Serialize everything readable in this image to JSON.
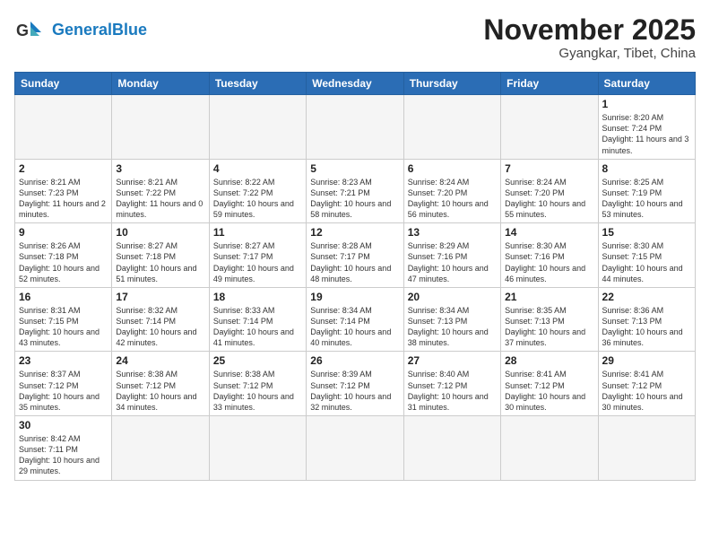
{
  "logo": {
    "general": "General",
    "blue": "Blue"
  },
  "title": "November 2025",
  "subtitle": "Gyangkar, Tibet, China",
  "days_of_week": [
    "Sunday",
    "Monday",
    "Tuesday",
    "Wednesday",
    "Thursday",
    "Friday",
    "Saturday"
  ],
  "weeks": [
    [
      {
        "day": "",
        "info": ""
      },
      {
        "day": "",
        "info": ""
      },
      {
        "day": "",
        "info": ""
      },
      {
        "day": "",
        "info": ""
      },
      {
        "day": "",
        "info": ""
      },
      {
        "day": "",
        "info": ""
      },
      {
        "day": "1",
        "info": "Sunrise: 8:20 AM\nSunset: 7:24 PM\nDaylight: 11 hours and 3 minutes."
      }
    ],
    [
      {
        "day": "2",
        "info": "Sunrise: 8:21 AM\nSunset: 7:23 PM\nDaylight: 11 hours and 2 minutes."
      },
      {
        "day": "3",
        "info": "Sunrise: 8:21 AM\nSunset: 7:22 PM\nDaylight: 11 hours and 0 minutes."
      },
      {
        "day": "4",
        "info": "Sunrise: 8:22 AM\nSunset: 7:22 PM\nDaylight: 10 hours and 59 minutes."
      },
      {
        "day": "5",
        "info": "Sunrise: 8:23 AM\nSunset: 7:21 PM\nDaylight: 10 hours and 58 minutes."
      },
      {
        "day": "6",
        "info": "Sunrise: 8:24 AM\nSunset: 7:20 PM\nDaylight: 10 hours and 56 minutes."
      },
      {
        "day": "7",
        "info": "Sunrise: 8:24 AM\nSunset: 7:20 PM\nDaylight: 10 hours and 55 minutes."
      },
      {
        "day": "8",
        "info": "Sunrise: 8:25 AM\nSunset: 7:19 PM\nDaylight: 10 hours and 53 minutes."
      }
    ],
    [
      {
        "day": "9",
        "info": "Sunrise: 8:26 AM\nSunset: 7:18 PM\nDaylight: 10 hours and 52 minutes."
      },
      {
        "day": "10",
        "info": "Sunrise: 8:27 AM\nSunset: 7:18 PM\nDaylight: 10 hours and 51 minutes."
      },
      {
        "day": "11",
        "info": "Sunrise: 8:27 AM\nSunset: 7:17 PM\nDaylight: 10 hours and 49 minutes."
      },
      {
        "day": "12",
        "info": "Sunrise: 8:28 AM\nSunset: 7:17 PM\nDaylight: 10 hours and 48 minutes."
      },
      {
        "day": "13",
        "info": "Sunrise: 8:29 AM\nSunset: 7:16 PM\nDaylight: 10 hours and 47 minutes."
      },
      {
        "day": "14",
        "info": "Sunrise: 8:30 AM\nSunset: 7:16 PM\nDaylight: 10 hours and 46 minutes."
      },
      {
        "day": "15",
        "info": "Sunrise: 8:30 AM\nSunset: 7:15 PM\nDaylight: 10 hours and 44 minutes."
      }
    ],
    [
      {
        "day": "16",
        "info": "Sunrise: 8:31 AM\nSunset: 7:15 PM\nDaylight: 10 hours and 43 minutes."
      },
      {
        "day": "17",
        "info": "Sunrise: 8:32 AM\nSunset: 7:14 PM\nDaylight: 10 hours and 42 minutes."
      },
      {
        "day": "18",
        "info": "Sunrise: 8:33 AM\nSunset: 7:14 PM\nDaylight: 10 hours and 41 minutes."
      },
      {
        "day": "19",
        "info": "Sunrise: 8:34 AM\nSunset: 7:14 PM\nDaylight: 10 hours and 40 minutes."
      },
      {
        "day": "20",
        "info": "Sunrise: 8:34 AM\nSunset: 7:13 PM\nDaylight: 10 hours and 38 minutes."
      },
      {
        "day": "21",
        "info": "Sunrise: 8:35 AM\nSunset: 7:13 PM\nDaylight: 10 hours and 37 minutes."
      },
      {
        "day": "22",
        "info": "Sunrise: 8:36 AM\nSunset: 7:13 PM\nDaylight: 10 hours and 36 minutes."
      }
    ],
    [
      {
        "day": "23",
        "info": "Sunrise: 8:37 AM\nSunset: 7:12 PM\nDaylight: 10 hours and 35 minutes."
      },
      {
        "day": "24",
        "info": "Sunrise: 8:38 AM\nSunset: 7:12 PM\nDaylight: 10 hours and 34 minutes."
      },
      {
        "day": "25",
        "info": "Sunrise: 8:38 AM\nSunset: 7:12 PM\nDaylight: 10 hours and 33 minutes."
      },
      {
        "day": "26",
        "info": "Sunrise: 8:39 AM\nSunset: 7:12 PM\nDaylight: 10 hours and 32 minutes."
      },
      {
        "day": "27",
        "info": "Sunrise: 8:40 AM\nSunset: 7:12 PM\nDaylight: 10 hours and 31 minutes."
      },
      {
        "day": "28",
        "info": "Sunrise: 8:41 AM\nSunset: 7:12 PM\nDaylight: 10 hours and 30 minutes."
      },
      {
        "day": "29",
        "info": "Sunrise: 8:41 AM\nSunset: 7:12 PM\nDaylight: 10 hours and 30 minutes."
      }
    ],
    [
      {
        "day": "30",
        "info": "Sunrise: 8:42 AM\nSunset: 7:11 PM\nDaylight: 10 hours and 29 minutes."
      },
      {
        "day": "",
        "info": ""
      },
      {
        "day": "",
        "info": ""
      },
      {
        "day": "",
        "info": ""
      },
      {
        "day": "",
        "info": ""
      },
      {
        "day": "",
        "info": ""
      },
      {
        "day": "",
        "info": ""
      }
    ]
  ]
}
